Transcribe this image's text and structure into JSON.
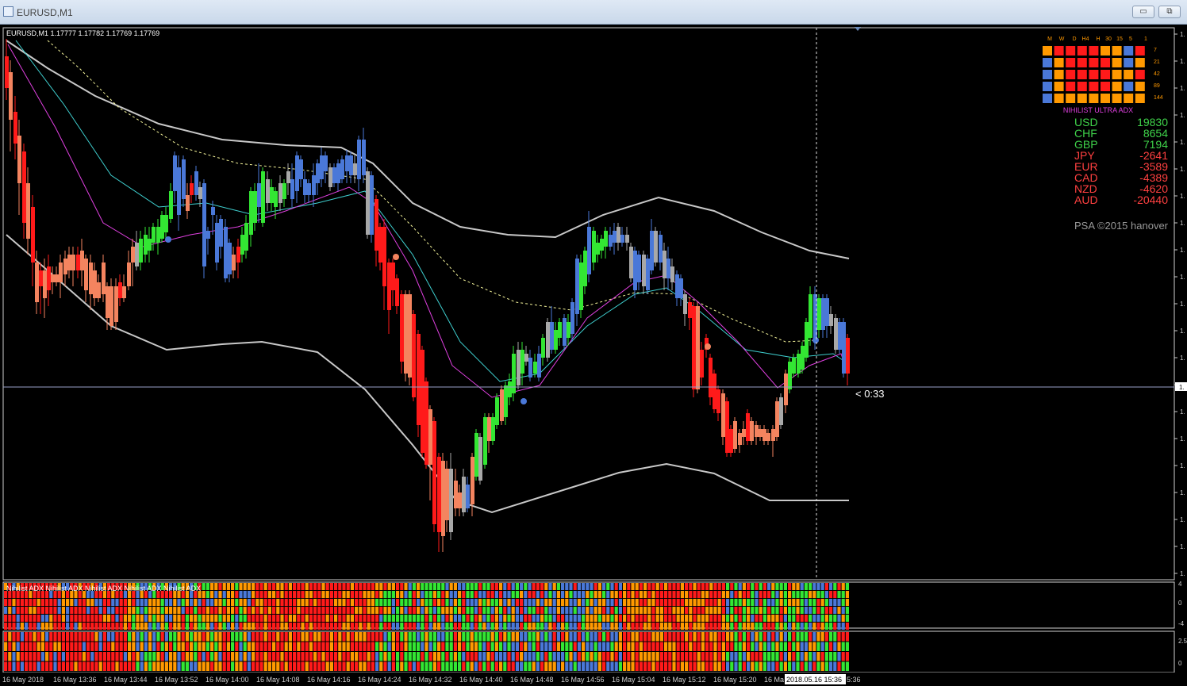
{
  "window": {
    "title": "EURUSD,M1",
    "min_label": "▭",
    "restore_label": "⧉",
    "close_label": "✕"
  },
  "chart_info": "EURUSD,M1  1.17777 1.17782 1.17769 1.17769",
  "countdown": "< 0:33",
  "watermark": "PSA ©2015 hanover",
  "colors": {
    "bull": "#33e633",
    "bear": "#ff1a1a",
    "salmon": "#f4845f",
    "blue": "#4a78d8",
    "gray": "#a8a8a8",
    "orange": "#ff9900"
  },
  "matrix": {
    "headers": [
      "M",
      "W",
      "D",
      "H4",
      "H",
      "30",
      "15",
      "5",
      "1"
    ],
    "row_labels": [
      "7",
      "21",
      "42",
      "89",
      "144"
    ],
    "title": "NIHILIST ULTRA ADX",
    "cells": [
      [
        "o",
        "r",
        "r",
        "r",
        "r",
        "o",
        "o",
        "b",
        "r"
      ],
      [
        "b",
        "o",
        "r",
        "r",
        "r",
        "r",
        "o",
        "b",
        "o"
      ],
      [
        "b",
        "o",
        "r",
        "r",
        "r",
        "r",
        "o",
        "o",
        "r"
      ],
      [
        "b",
        "o",
        "r",
        "r",
        "r",
        "r",
        "o",
        "b",
        "o"
      ],
      [
        "b",
        "o",
        "o",
        "o",
        "o",
        "o",
        "o",
        "o",
        "o"
      ]
    ]
  },
  "strength": [
    {
      "currency": "USD",
      "value": "19830"
    },
    {
      "currency": "CHF",
      "value": "8654"
    },
    {
      "currency": "GBP",
      "value": "7194"
    },
    {
      "currency": "JPY",
      "value": "-2641"
    },
    {
      "currency": "EUR",
      "value": "-3589"
    },
    {
      "currency": "CAD",
      "value": "-4389"
    },
    {
      "currency": "NZD",
      "value": "-4620"
    },
    {
      "currency": "AUD",
      "value": "-20440"
    }
  ],
  "time_labels": [
    "16 May 2018",
    "16 May 13:36",
    "16 May 13:44",
    "16 May 13:52",
    "16 May 14:00",
    "16 May 14:08",
    "16 May 14:16",
    "16 May 14:24",
    "16 May 14:32",
    "16 May 14:40",
    "16 May 14:48",
    "16 May 14:56",
    "16 May 15:04",
    "16 May 15:12",
    "16 May 15:20",
    "16 Ma"
  ],
  "time_cursor": "2018.05.16 15:36",
  "time_tail": "5:36",
  "price_ticks": [
    "1.",
    "1.",
    "1.",
    "1.",
    "1.",
    "1.",
    "1.",
    "1.",
    "1.",
    "1.",
    "1.",
    "1.",
    "1.",
    "1.",
    "1.",
    "1.",
    "1.",
    "1.",
    "1.",
    "1.",
    "1."
  ],
  "sub_axis_1": [
    "4",
    "0",
    "-4"
  ],
  "sub_axis_2": [
    "2.5",
    "0"
  ],
  "sub_legend": "Nihilist  ADX  Nihilist  ADX  Nihilist  ADX  Nihilist  ADX  Nihilist  ADX"
}
